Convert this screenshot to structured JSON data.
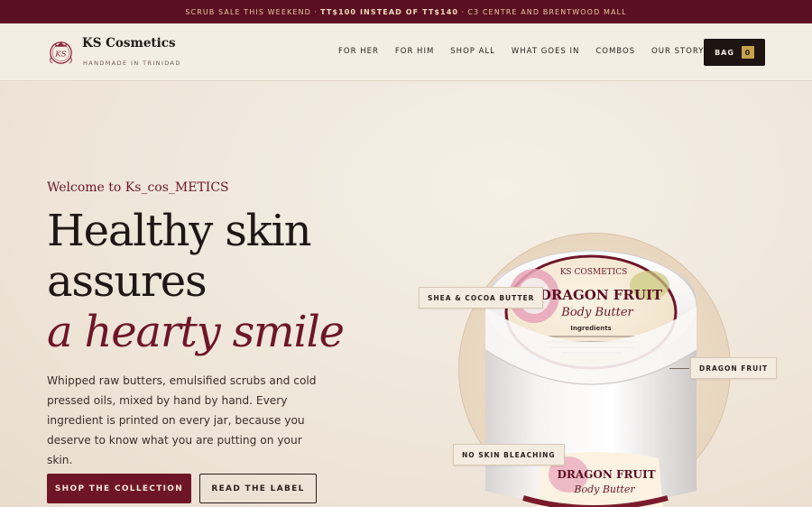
{
  "announcement": {
    "lead": "SCRUB SALE THIS WEEKEND ·",
    "highlight": "TT$100 INSTEAD OF TT$140",
    "tail": "· C3 CENTRE AND BRENTWOOD MALL"
  },
  "brand": {
    "name": "KS Cosmetics",
    "tagline": "HANDMADE IN TRINIDAD",
    "monogram": "KS"
  },
  "nav": {
    "items": [
      "FOR HER",
      "FOR HIM",
      "SHOP ALL",
      "WHAT GOES IN",
      "COMBOS",
      "OUR STORY"
    ]
  },
  "bag": {
    "label": "BAG",
    "count": "0"
  },
  "hero": {
    "eyebrow": "Welcome to Ks_cos_METICS",
    "headline_line1": "Healthy skin",
    "headline_line2": "assures",
    "headline_accent": "a hearty smile",
    "body": "Whipped raw butters, emulsified scrubs and cold pressed oils, mixed by hand by hand. Every ingredient is printed on every jar, because you deserve to know what you are putting on your skin.",
    "primary_cta": "SHOP THE COLLECTION",
    "secondary_cta": "READ THE LABEL"
  },
  "product": {
    "label_title": "DRAGON FRUIT",
    "label_subtitle": "Body Butter",
    "label_brand": "KS COSMETICS",
    "label_ingredients_heading": "Ingredients",
    "tags": [
      "SHEA & COCOA BUTTER",
      "DRAGON FRUIT",
      "NO SKIN BLEACHING"
    ]
  },
  "colors": {
    "announcement_bg": "#5b0f22",
    "accent": "#6e1628",
    "background": "#f1e9df",
    "dark": "#1e1412",
    "badge": "#c7a24a"
  }
}
